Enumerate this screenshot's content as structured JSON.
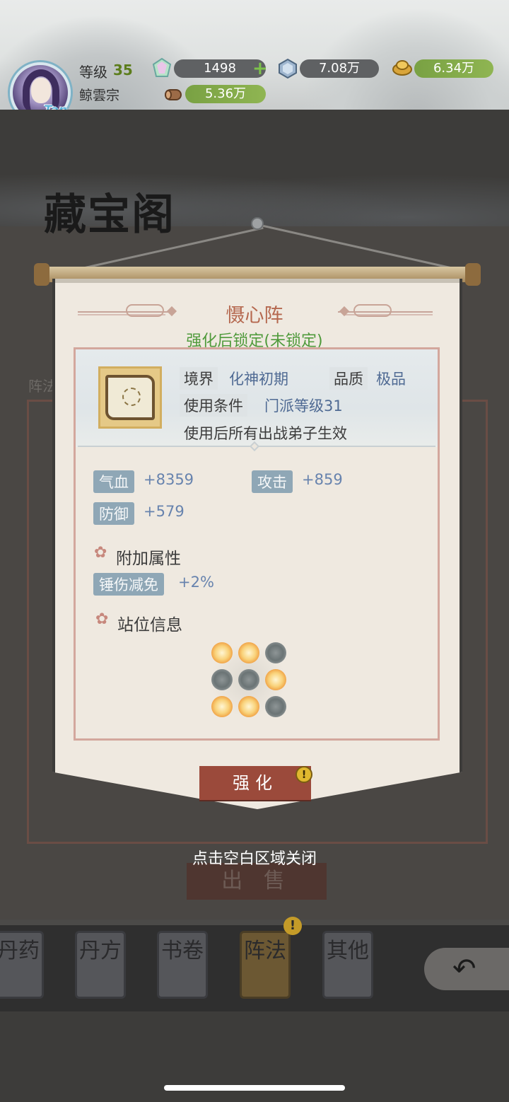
{
  "player": {
    "level_label": "等级",
    "level": "35",
    "sect": "鲸雲宗",
    "avatar_badge": "Tap"
  },
  "resources": [
    {
      "name": "spirit-crystal",
      "value": "1498",
      "icon": "crystal-icon"
    },
    {
      "name": "gem",
      "value": "7.08万",
      "icon": "gem-icon"
    },
    {
      "name": "gold",
      "value": "6.34万",
      "icon": "gold-ingot-icon"
    },
    {
      "name": "wood",
      "value": "5.36万",
      "icon": "log-icon"
    }
  ],
  "shop": {
    "title": "藏宝阁",
    "tag": "阵法",
    "sell_label": "出 售",
    "close_hint": "点击空白区域关闭"
  },
  "item": {
    "name": "慑心阵",
    "lock_state": "强化后锁定(未锁定)",
    "realm_key": "境界",
    "realm_value": "化神初期",
    "quality_key": "品质",
    "quality_value": "极品",
    "condition_key": "使用条件",
    "condition_value": "门派等级31",
    "effect": "使用后所有出战弟子生效",
    "stats": [
      {
        "key": "气血",
        "value": "+8359"
      },
      {
        "key": "攻击",
        "value": "+859"
      },
      {
        "key": "防御",
        "value": "+579"
      }
    ],
    "extra_title": "附加属性",
    "extra_stats": [
      {
        "key": "锤伤减免",
        "value": "+2%"
      }
    ],
    "position_title": "站位信息",
    "formation_grid": [
      [
        1,
        1,
        0
      ],
      [
        0,
        0,
        1
      ],
      [
        1,
        1,
        0
      ]
    ],
    "upgrade_label": "强化",
    "alert_symbol": "!"
  },
  "tabs": [
    {
      "label": "丹药",
      "active": false
    },
    {
      "label": "丹方",
      "active": false
    },
    {
      "label": "书卷",
      "active": false
    },
    {
      "label": "阵法",
      "active": true
    },
    {
      "label": "其他",
      "active": false
    }
  ],
  "back_icon": "↶",
  "colors": {
    "accent_title": "#b5684f",
    "lock_green": "#4f9a3b",
    "value_blue": "#4f6a93",
    "button_red": "#9b4a3b"
  }
}
